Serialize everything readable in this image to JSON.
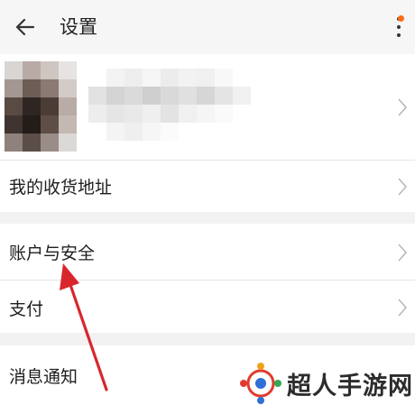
{
  "header": {
    "title": "设置",
    "back_icon": "arrow-left-icon",
    "more_icon": "more-vertical-icon"
  },
  "menu": {
    "address": "我的收货地址",
    "account_security": "账户与安全",
    "payment": "支付",
    "notifications": "消息通知"
  },
  "watermark": {
    "text": "超人手游网"
  },
  "colors": {
    "accent_dot": "#ff6a1a",
    "annotation_arrow": "#d9262c"
  }
}
